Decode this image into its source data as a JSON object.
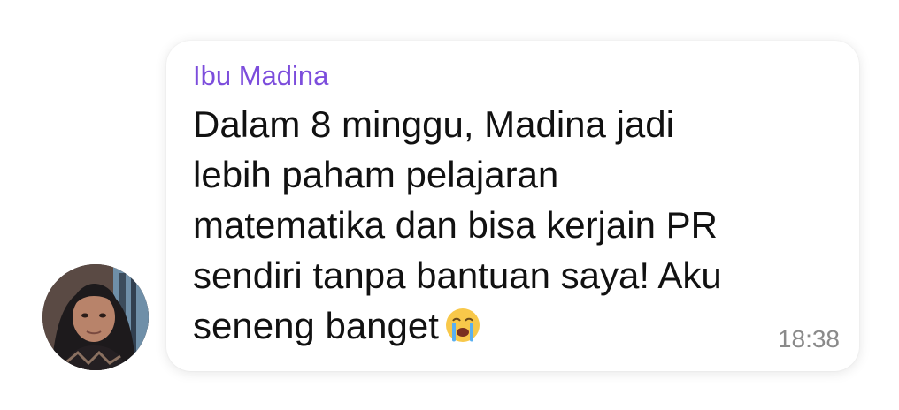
{
  "chat": {
    "sender_name": "Ibu Madina",
    "message_text": "Dalam 8 minggu, Madina jadi\nlebih paham pelajaran\nmatematika dan bisa kerjain PR\nsendiri tanpa bantuan saya! Aku\nseneng banget",
    "emoji": "loudly-crying-face",
    "timestamp": "18:38"
  },
  "colors": {
    "sender": "#7c4ddc",
    "text": "#111111",
    "timestamp": "#8a8a8a",
    "bubble": "#ffffff"
  }
}
